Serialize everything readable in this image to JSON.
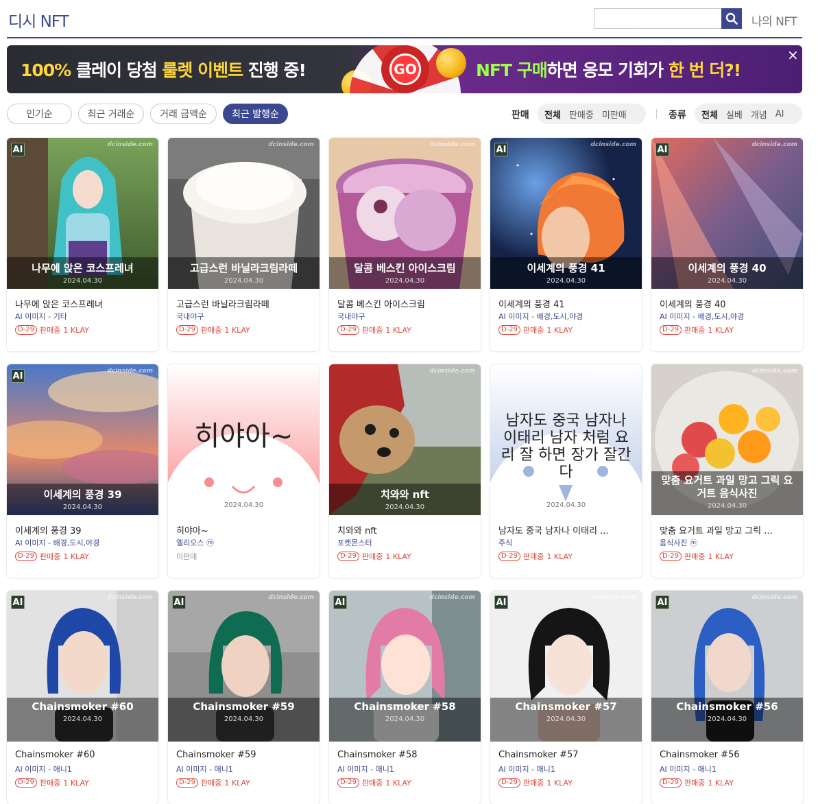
{
  "header": {
    "logo": "디시 NFT",
    "search_placeholder": "",
    "my_nft": "나의 NFT"
  },
  "banner": {
    "left_part1": "100% ",
    "left_part2": "클레이 당첨 ",
    "left_part3": "룰렛 이벤트",
    "left_part4": " 진행 중!",
    "go": "GO",
    "right_part1": "NFT 구매",
    "right_part2": "하면 응모 기회가 ",
    "right_part3": "한 번 더?!",
    "close": "×"
  },
  "sort": [
    "인기순",
    "최근 거래순",
    "거래 금액순",
    "최근 발행순"
  ],
  "sort_active": "최근 발행순",
  "filters": {
    "sale_label": "판매",
    "sale_options": [
      "전체",
      "판매중",
      "미판매"
    ],
    "type_label": "종류",
    "type_options": [
      "전체",
      "실베",
      "개념",
      "AI"
    ]
  },
  "watermark": "dcinside.com",
  "cards": [
    {
      "ai": "AI",
      "overlay": "나무에 앉은 코스프레녀",
      "date": "2024.04.30",
      "name": "나무에 앉은 코스프레녀",
      "cat": "AI 이미지 - 기타",
      "dday": "D-29",
      "status": "판매중",
      "price": "1 KLAY"
    },
    {
      "ai": "",
      "overlay": "고급스런 바닐라크림라떼",
      "date": "2024.04.30",
      "name": "고급스런 바닐라크림라떼",
      "cat": "국내야구",
      "dday": "D-29",
      "status": "판매중",
      "price": "1 KLAY"
    },
    {
      "ai": "",
      "overlay": "달콤 베스킨 아이스크림",
      "date": "2024.04.30",
      "name": "달콤 베스킨 아이스크림",
      "cat": "국내야구",
      "dday": "D-29",
      "status": "판매중",
      "price": "1 KLAY"
    },
    {
      "ai": "AI",
      "overlay": "이세계의 풍경 41",
      "date": "2024.04.30",
      "name": "이세계의 풍경 41",
      "cat": "AI 이미지 - 배경,도시,야경",
      "dday": "D-29",
      "status": "판매중",
      "price": "1 KLAY"
    },
    {
      "ai": "AI",
      "overlay": "이세계의 풍경 40",
      "date": "2024.04.30",
      "name": "이세계의 풍경 40",
      "cat": "AI 이미지 - 배경,도시,야경",
      "dday": "D-29",
      "status": "판매중",
      "price": "1 KLAY"
    },
    {
      "ai": "AI",
      "overlay": "이세계의 풍경 39",
      "date": "2024.04.30",
      "name": "이세계의 풍경 39",
      "cat": "AI 이미지 - 배경,도시,야경",
      "dday": "D-29",
      "status": "판매중",
      "price": "1 KLAY"
    },
    {
      "ai": "",
      "overlay": "",
      "image_text": "히야아~",
      "date": "2024.04.30",
      "name": "히야아~",
      "cat": "엘리오스 ⓜ",
      "dday": "",
      "status": "미판매",
      "price": ""
    },
    {
      "ai": "",
      "overlay": "치와와 nft",
      "date": "2024.04.30",
      "name": "치와와 nft",
      "cat": "포켓몬스터",
      "dday": "D-29",
      "status": "판매중",
      "price": "1 KLAY"
    },
    {
      "ai": "",
      "overlay": "",
      "image_text": "남자도 중국 남자나 이태리 남자 처럼 요리 잘 하면 장가 잘간다",
      "date": "2024.04.30",
      "name": "남자도 중국 남자나 이태리 ...",
      "cat": "주식",
      "dday": "D-29",
      "status": "판매중",
      "price": "1 KLAY"
    },
    {
      "ai": "",
      "overlay": "맞춤 요거트 과일 망고 그릭 요거트 음식사진",
      "date": "2024.04.30",
      "name": "맞춤 요거트 과일 망고 그릭 ...",
      "cat": "음식사진 ⓜ",
      "dday": "D-29",
      "status": "판매중",
      "price": "1 KLAY"
    },
    {
      "ai": "AI",
      "overlay": "Chainsmoker #60",
      "date": "2024.04.30",
      "name": "Chainsmoker #60",
      "cat": "AI 이미지 - 애니1",
      "dday": "D-29",
      "status": "판매중",
      "price": "1 KLAY"
    },
    {
      "ai": "AI",
      "overlay": "Chainsmoker #59",
      "date": "2024.04.30",
      "name": "Chainsmoker #59",
      "cat": "AI 이미지 - 애니1",
      "dday": "D-29",
      "status": "판매중",
      "price": "1 KLAY"
    },
    {
      "ai": "AI",
      "overlay": "Chainsmoker #58",
      "date": "2024.04.30",
      "name": "Chainsmoker #58",
      "cat": "AI 이미지 - 애니1",
      "dday": "D-29",
      "status": "판매중",
      "price": "1 KLAY"
    },
    {
      "ai": "AI",
      "overlay": "Chainsmoker #57",
      "date": "2024.04.30",
      "name": "Chainsmoker #57",
      "cat": "AI 이미지 - 애니1",
      "dday": "D-29",
      "status": "판매중",
      "price": "1 KLAY"
    },
    {
      "ai": "AI",
      "overlay": "Chainsmoker #56",
      "date": "2024.04.30",
      "name": "Chainsmoker #56",
      "cat": "AI 이미지 - 애니1",
      "dday": "D-29",
      "status": "판매중",
      "price": "1 KLAY"
    }
  ],
  "colors": {
    "accent": "#3b4890",
    "sale": "#e0463a"
  }
}
